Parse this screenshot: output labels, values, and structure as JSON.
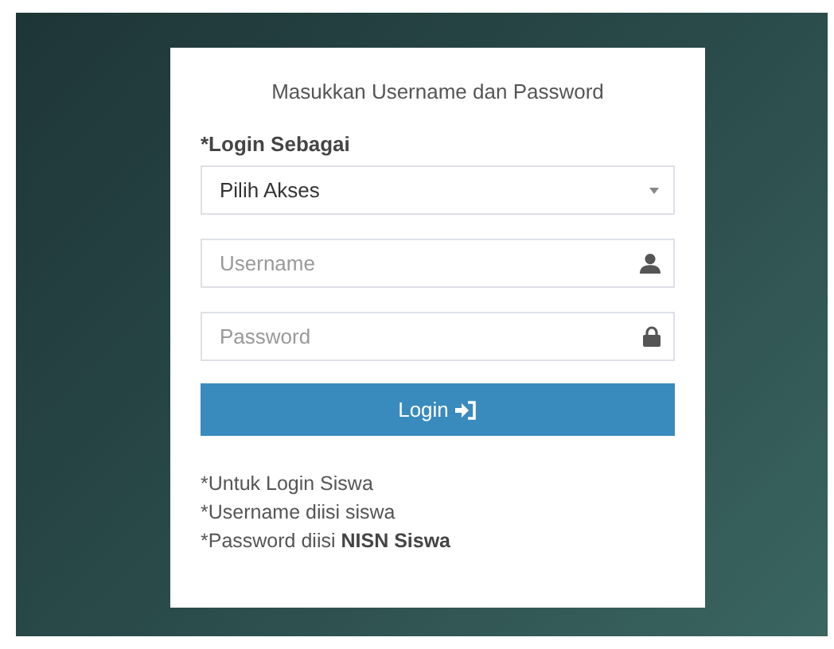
{
  "login_form": {
    "title": "Masukkan Username dan Password",
    "role_label": "*Login Sebagai",
    "role_select": {
      "value": "Pilih Akses"
    },
    "username": {
      "placeholder": "Username"
    },
    "password": {
      "placeholder": "Password"
    },
    "login_button": {
      "label": "Login"
    },
    "notes": [
      "*Untuk Login Siswa",
      "*Username diisi siswa",
      "*Password diisi **NISN Siswa**"
    ]
  }
}
